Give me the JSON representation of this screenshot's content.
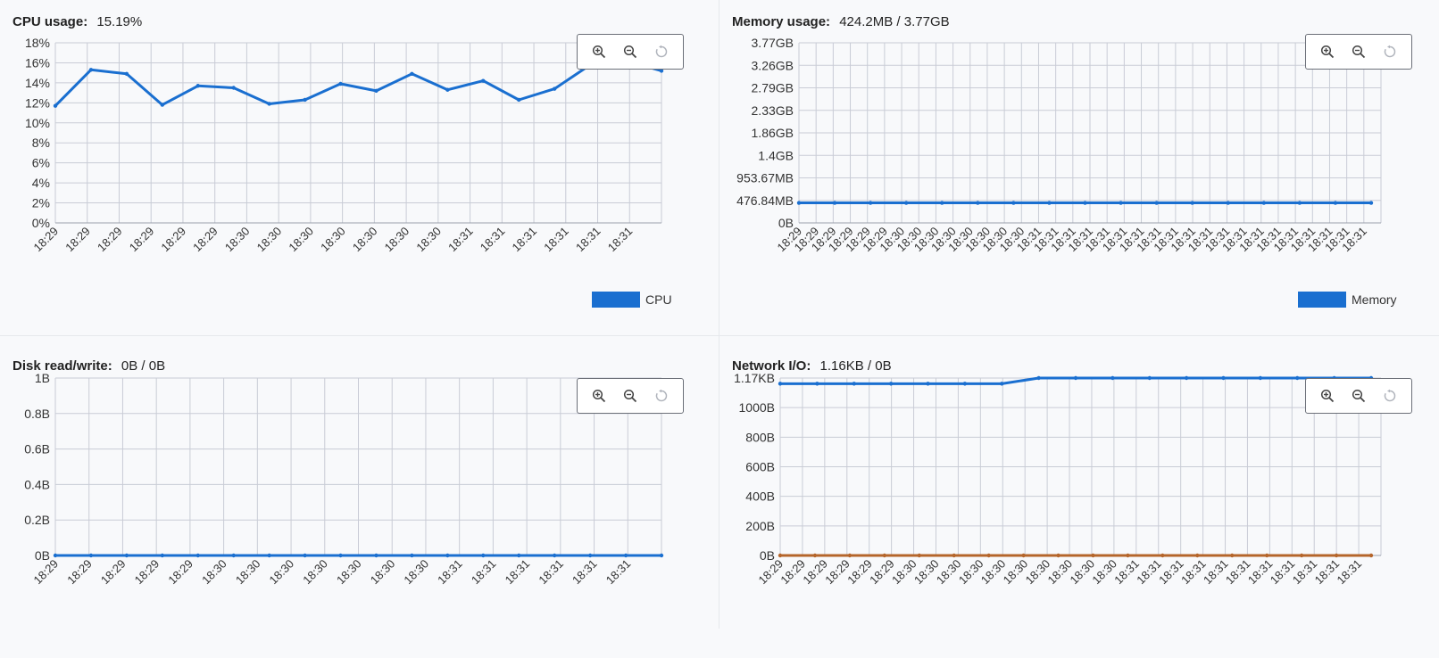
{
  "colors": {
    "series_blue": "#1a6fd0",
    "series_orange": "#b5652a",
    "grid": "#c9ccd6",
    "axis_text": "#333333"
  },
  "icons": {
    "zoom_in": "zoom-in-icon",
    "zoom_out": "zoom-out-icon",
    "reset": "reset-icon"
  },
  "panels": [
    {
      "label": "CPU usage:",
      "value": "15.19%",
      "legend": "CPU",
      "chart_data": {
        "type": "line",
        "x": [
          "18:29",
          "18:29",
          "18:29",
          "18:29",
          "18:29",
          "18:29",
          "18:30",
          "18:30",
          "18:30",
          "18:30",
          "18:30",
          "18:30",
          "18:30",
          "18:31",
          "18:31",
          "18:31",
          "18:31",
          "18:31",
          "18:31"
        ],
        "yticks": [
          "18%",
          "16%",
          "14%",
          "12%",
          "10%",
          "8%",
          "6%",
          "4%",
          "2%",
          "0%"
        ],
        "ylim": [
          0,
          18
        ],
        "series": [
          {
            "name": "CPU",
            "color": "#1a6fd0",
            "values": [
              11.7,
              15.3,
              14.9,
              11.8,
              13.7,
              13.5,
              11.9,
              12.3,
              13.9,
              13.2,
              14.9,
              13.3,
              14.2,
              12.3,
              13.4,
              15.8,
              16.2,
              15.2
            ]
          }
        ]
      }
    },
    {
      "label": "Memory usage:",
      "value": "424.2MB / 3.77GB",
      "legend": "Memory",
      "chart_data": {
        "type": "line",
        "x": [
          "18:29",
          "18:29",
          "18:29",
          "18:29",
          "18:29",
          "18:29",
          "18:30",
          "18:30",
          "18:30",
          "18:30",
          "18:30",
          "18:30",
          "18:30",
          "18:30",
          "18:31",
          "18:31",
          "18:31",
          "18:31",
          "18:31",
          "18:31",
          "18:31",
          "18:31",
          "18:31",
          "18:31",
          "18:31",
          "18:31",
          "18:31",
          "18:31",
          "18:31",
          "18:31",
          "18:31",
          "18:31",
          "18:31",
          "18:31"
        ],
        "x_display": [
          "18:29",
          "18:29",
          "18:29",
          "18:29",
          "18:29",
          "18:29",
          "18:30",
          "18:30",
          "18:30",
          "18:30",
          "18:30",
          "18:30",
          "18:30",
          "18:30",
          "18:31",
          "18:31",
          "18:31",
          "18:31",
          "18:31",
          "18:31",
          "18:31",
          "18:31",
          "18:31",
          "18:31",
          "18:31",
          "18:31",
          "18:31",
          "18:31",
          "18:31",
          "18:31",
          "18:31",
          "18:31",
          "18:31",
          "18:31"
        ],
        "yticks": [
          "3.77GB",
          "3.26GB",
          "2.79GB",
          "2.33GB",
          "1.86GB",
          "1.4GB",
          "953.67MB",
          "476.84MB",
          "0B"
        ],
        "ylim": [
          0,
          8
        ],
        "series": [
          {
            "name": "Memory",
            "color": "#1a6fd0",
            "values": [
              0.89,
              0.89,
              0.89,
              0.89,
              0.89,
              0.89,
              0.89,
              0.89,
              0.89,
              0.89,
              0.89,
              0.89,
              0.89,
              0.89,
              0.89,
              0.89,
              0.89
            ]
          }
        ]
      }
    },
    {
      "label": "Disk read/write:",
      "value": "0B / 0B",
      "legend": "",
      "chart_data": {
        "type": "line",
        "x": [
          "18:29",
          "18:29",
          "18:29",
          "18:29",
          "18:29",
          "18:30",
          "18:30",
          "18:30",
          "18:30",
          "18:30",
          "18:30",
          "18:30",
          "18:31",
          "18:31",
          "18:31",
          "18:31",
          "18:31",
          "18:31"
        ],
        "yticks": [
          "1B",
          "0.8B",
          "0.6B",
          "0.4B",
          "0.2B",
          "0B"
        ],
        "ylim": [
          0,
          1
        ],
        "series": [
          {
            "name": "",
            "color": "#1a6fd0",
            "values": [
              0,
              0,
              0,
              0,
              0,
              0,
              0,
              0,
              0,
              0,
              0,
              0,
              0,
              0,
              0,
              0,
              0,
              0
            ]
          }
        ]
      }
    },
    {
      "label": "Network I/O:",
      "value": "1.16KB / 0B",
      "legend": "",
      "chart_data": {
        "type": "line",
        "x": [
          "18:29",
          "18:29",
          "18:29",
          "18:29",
          "18:29",
          "18:30",
          "18:30",
          "18:30",
          "18:30",
          "18:30",
          "18:30",
          "18:30",
          "18:30",
          "18:30",
          "18:31",
          "18:31",
          "18:31",
          "18:31",
          "18:31",
          "18:31",
          "18:31",
          "18:31",
          "18:31",
          "18:31",
          "18:31",
          "18:31",
          "18:31"
        ],
        "x_display": [
          "18:29",
          "18:29",
          "18:29",
          "18:29",
          "18:29",
          "18:29",
          "18:30",
          "18:30",
          "18:30",
          "18:30",
          "18:30",
          "18:30",
          "18:30",
          "18:30",
          "18:30",
          "18:30",
          "18:31",
          "18:31",
          "18:31",
          "18:31",
          "18:31",
          "18:31",
          "18:31",
          "18:31",
          "18:31",
          "18:31",
          "18:31"
        ],
        "yticks": [
          "1.17KB",
          "1000B",
          "800B",
          "600B",
          "400B",
          "200B",
          "0B"
        ],
        "ylim": [
          0,
          1188
        ],
        "series": [
          {
            "name": "",
            "color": "#1a6fd0",
            "values": [
              1150,
              1150,
              1150,
              1150,
              1150,
              1150,
              1150,
              1188,
              1188,
              1188,
              1188,
              1188,
              1188,
              1188,
              1188,
              1188,
              1188
            ]
          },
          {
            "name": "",
            "color": "#b5652a",
            "values": [
              0,
              0,
              0,
              0,
              0,
              0,
              0,
              0,
              0,
              0,
              0,
              0,
              0,
              0,
              0,
              0,
              0,
              0
            ]
          }
        ]
      }
    }
  ]
}
